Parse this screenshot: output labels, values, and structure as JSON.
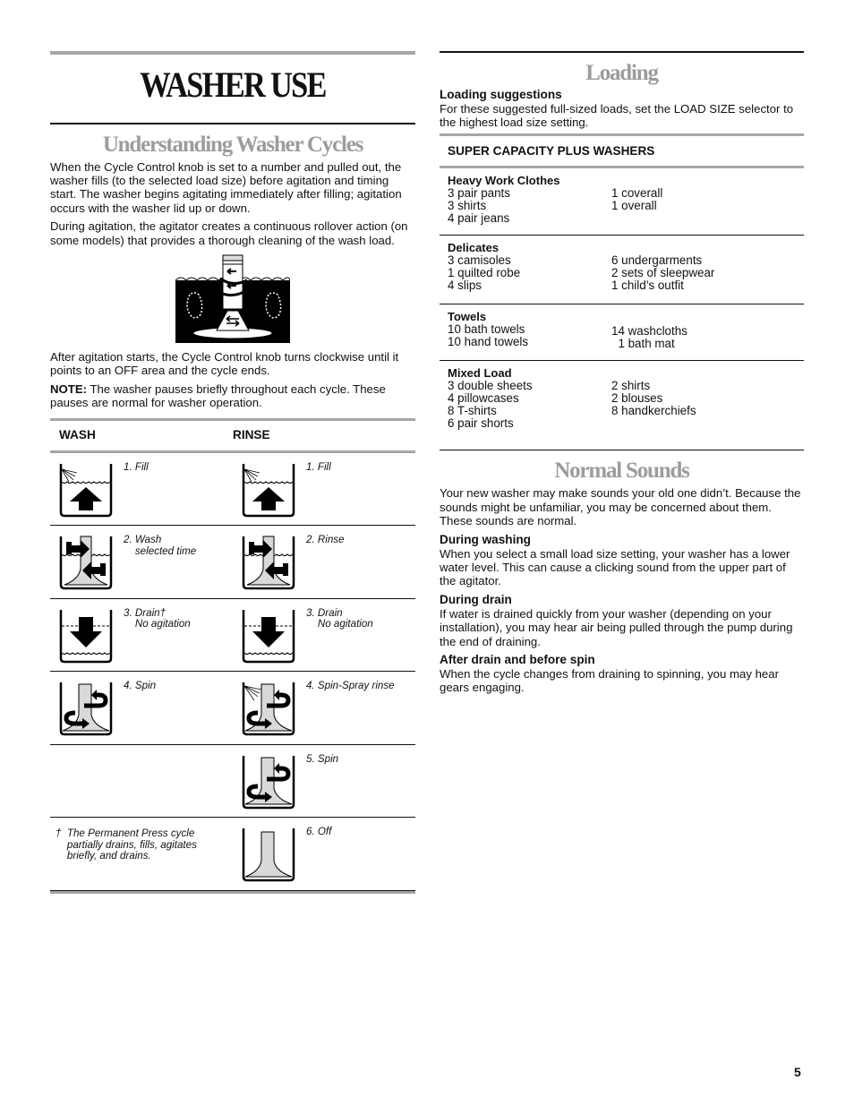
{
  "page": {
    "title": "WASHER USE",
    "page_number": "5"
  },
  "cycles_section": {
    "title": "Understanding Washer Cycles",
    "paragraphs": [
      "When the Cycle Control knob is set to a number and pulled out, the washer fills (to the selected load size) before agitation and timing start. The washer begins agitating immediately after filling; agitation occurs with the washer lid up or down.",
      "During agitation, the agitator creates a continuous rollover action (on some models) that provides a thorough cleaning of the wash load.",
      "After agitation starts, the Cycle Control knob turns clockwise until it points to an OFF area and the cycle ends."
    ],
    "note_label": "NOTE:",
    "note_text": " The washer pauses briefly throughout each cycle. These pauses are normal for washer operation.",
    "illustration_icon": "agitator-rollover-icon",
    "table": {
      "headers": {
        "wash": "WASH",
        "rinse": "RINSE"
      },
      "rows": [
        {
          "wash": {
            "label": "1. Fill",
            "icon": "fill-icon"
          },
          "rinse": {
            "label": "1. Fill",
            "icon": "fill-icon"
          }
        },
        {
          "wash": {
            "label": "2. Wash\n    selected time",
            "icon": "agitate-icon"
          },
          "rinse": {
            "label": "2. Rinse",
            "icon": "agitate-icon"
          }
        },
        {
          "wash": {
            "label": "3. Drain†\n    No agitation",
            "icon": "drain-icon"
          },
          "rinse": {
            "label": "3. Drain\n    No agitation",
            "icon": "drain-icon"
          }
        },
        {
          "wash": {
            "label": "4. Spin",
            "icon": "spin-icon"
          },
          "rinse": {
            "label": "4. Spin-Spray rinse",
            "icon": "spin-spray-icon"
          }
        },
        {
          "wash": null,
          "rinse": {
            "label": "5. Spin",
            "icon": "spin-icon"
          }
        },
        {
          "wash_footnote": "†  The Permanent Press cycle\n    partially drains, fills, agitates\n    briefly, and drains.",
          "rinse": {
            "label": "6. Off",
            "icon": "off-icon"
          }
        }
      ]
    }
  },
  "loading_section": {
    "title": "Loading",
    "subhead": "Loading suggestions",
    "intro": "For these suggested full-sized loads, set the LOAD SIZE selector to the highest load size setting.",
    "table_header": "SUPER CAPACITY PLUS WASHERS",
    "groups": [
      {
        "name": "Heavy Work Clothes",
        "col1": [
          "3 pair pants",
          "3 shirts",
          "4 pair jeans"
        ],
        "col2": [
          "1 coverall",
          "1 overall"
        ]
      },
      {
        "name": "Delicates",
        "col1": [
          "3 camisoles",
          "1 quilted robe",
          "4 slips"
        ],
        "col2": [
          "6 undergarments",
          "2 sets of sleepwear",
          "1 child’s outfit"
        ]
      },
      {
        "name": "Towels",
        "col1": [
          "10 bath towels",
          "10 hand towels"
        ],
        "col2": [
          "14 washcloths",
          "  1 bath mat"
        ]
      },
      {
        "name": "Mixed Load",
        "col1": [
          "3 double sheets",
          "4 pillowcases",
          "8 T-shirts",
          "6 pair shorts"
        ],
        "col2": [
          "2 shirts",
          "2 blouses",
          "8 handkerchiefs"
        ]
      }
    ]
  },
  "sounds_section": {
    "title": "Normal Sounds",
    "intro": "Your new washer may make sounds your old one didn’t. Because the sounds might be unfamiliar, you may be concerned about them. These sounds are normal.",
    "items": [
      {
        "heading": "During washing",
        "text": "When you select a small load size setting, your washer has a lower water level. This can cause a clicking sound from the upper part of the agitator."
      },
      {
        "heading": "During drain",
        "text": "If water is drained quickly from your washer (depending on your installation), you may hear air being pulled through the pump during the end of draining."
      },
      {
        "heading": "After drain and before spin",
        "text": "When the cycle changes from draining to spinning, you may hear gears engaging."
      }
    ]
  },
  "colors": {
    "section_title_gray": "#9c9c9c",
    "rule_gray": "#a6a6a6",
    "agitator_fill": "#d9d9d9"
  }
}
